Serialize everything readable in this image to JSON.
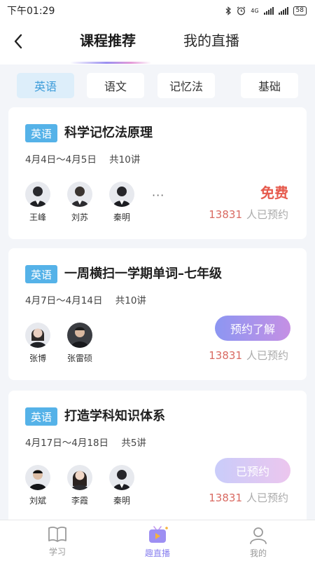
{
  "status_bar": {
    "time": "下午01:29",
    "network": "4G",
    "battery": "58"
  },
  "header": {
    "tabs": [
      "课程推荐",
      "我的直播"
    ],
    "active_tab": "课程推荐"
  },
  "categories": [
    "英语",
    "语文",
    "记忆法",
    "基础"
  ],
  "active_category": "英语",
  "courses": [
    {
      "tag": "英语",
      "title": "科学记忆法原理",
      "dates": "4月4日～4月5日",
      "lessons": "共10讲",
      "teachers": [
        "王峰",
        "刘苏",
        "秦明"
      ],
      "more": "···",
      "price": "免费",
      "booked_count": "13831",
      "booked_label": "人已预约"
    },
    {
      "tag": "英语",
      "title": "一周横扫一学期单词–七年级",
      "dates": "4月7日～4月14日",
      "lessons": "共10讲",
      "teachers": [
        "张博",
        "张雷硕"
      ],
      "action": "预约了解",
      "booked_count": "13831",
      "booked_label": "人已预约"
    },
    {
      "tag": "英语",
      "title": "打造学科知识体系",
      "dates": "4月17日～4月18日",
      "lessons": "共5讲",
      "teachers": [
        "刘斌",
        "李霞",
        "秦明"
      ],
      "action": "已预约",
      "booked_count": "13831",
      "booked_label": "人已预约"
    }
  ],
  "bottom_nav": [
    {
      "label": "学习",
      "icon": "book-icon"
    },
    {
      "label": "趣直播",
      "icon": "tv-play-icon"
    },
    {
      "label": "我的",
      "icon": "person-icon"
    }
  ],
  "active_nav": "趣直播",
  "colors": {
    "accent_blue": "#55b2e8",
    "free_red": "#e65a4d",
    "count_red": "#d96a62",
    "nav_active": "#8b83ef"
  }
}
